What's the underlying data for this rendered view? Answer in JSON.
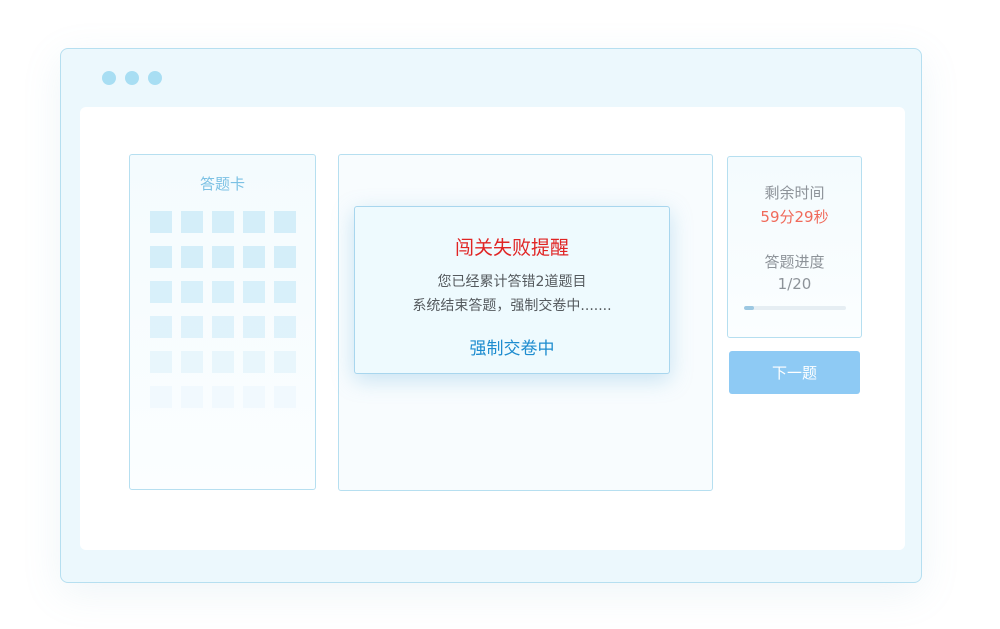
{
  "colors": {
    "frame_bg": "#ecf8fd",
    "frame_border": "#b6dff0",
    "window_dots": "#a8def3",
    "answer_cell": "#d4eef9",
    "alert_title": "#e02424",
    "action_blue": "#1d8ccf",
    "timer_red": "#f06a5a",
    "next_button": "#8ecaf4"
  },
  "answer_card": {
    "title": "答题卡",
    "rows": 6,
    "cols": 5
  },
  "modal": {
    "title": "闯关失败提醒",
    "line1": "您已经累计答错2道题目",
    "line2": "系统结束答题，强制交卷中.......",
    "action": "强制交卷中"
  },
  "timer": {
    "remaining_label": "剩余时间",
    "remaining_value": "59分29秒",
    "progress_label": "答题进度",
    "progress_value": "1/20",
    "progress_fraction": 0.1
  },
  "next_button_label": "下一题"
}
